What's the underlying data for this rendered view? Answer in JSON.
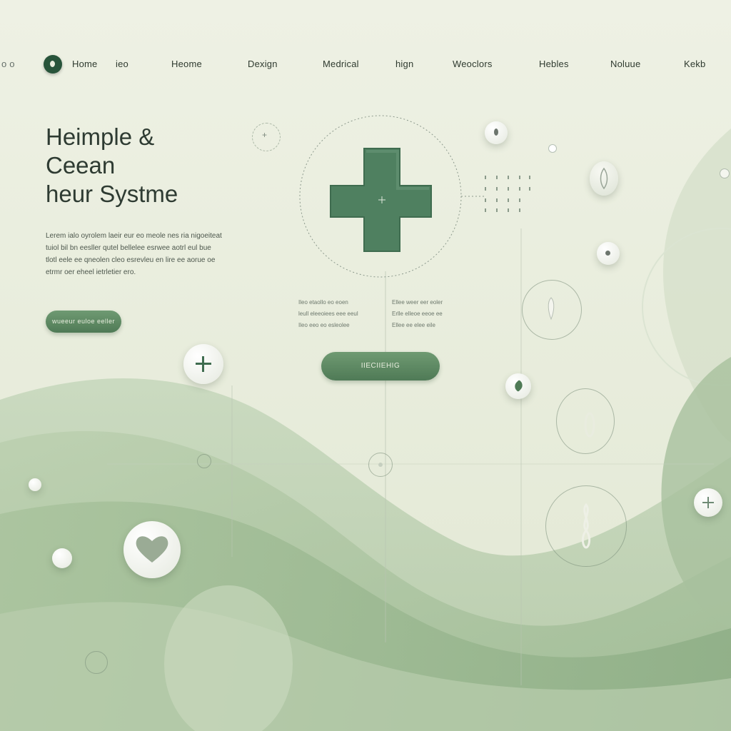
{
  "nav": {
    "items": [
      {
        "key": "home",
        "label": "Home"
      },
      {
        "key": "ieo",
        "label": "ieo"
      },
      {
        "key": "heome",
        "label": "Heome"
      },
      {
        "key": "design",
        "label": "Dexign"
      },
      {
        "key": "medical",
        "label": "Medrical"
      },
      {
        "key": "hign",
        "label": "hign"
      },
      {
        "key": "weoclors",
        "label": "Weoclors"
      },
      {
        "key": "hebles",
        "label": "Hebles"
      },
      {
        "key": "noluue",
        "label": "Noluue"
      },
      {
        "key": "kekb",
        "label": "Kekb"
      }
    ]
  },
  "hero": {
    "title_lines": [
      "Heimple &",
      "Ceean",
      "heur Systme"
    ],
    "body": "Lerem ialo oyrolem laeir eur eo meole nes ria nigoeiteat tuiol bil bn eesller qutel bellelee esrwee aotrl eul bue tlotl eele ee qneolen cleo esrevleu en lire ee aorue oe etrmr oer eheel ietrletier ero.",
    "cta_label": "wueeur euloe eeller"
  },
  "center": {
    "cta_label": "IIECIIEHIG",
    "col1": [
      "Ileo etaollo eo eoen",
      "leull eleeoiees eee eeul",
      "Ileo eeo eo esleolee"
    ],
    "col2": [
      "Ellee weer eer eoler",
      "Erlle elleoe eeoe ee",
      "Ellee ee elee eile"
    ]
  },
  "colors": {
    "accent": "#4f7a56",
    "dark": "#28543a",
    "cross": "#4f8060",
    "bg": "#e6ead9"
  },
  "icons": [
    "plus-icon",
    "heart-icon",
    "leaf-icon",
    "medical-cross-icon"
  ]
}
